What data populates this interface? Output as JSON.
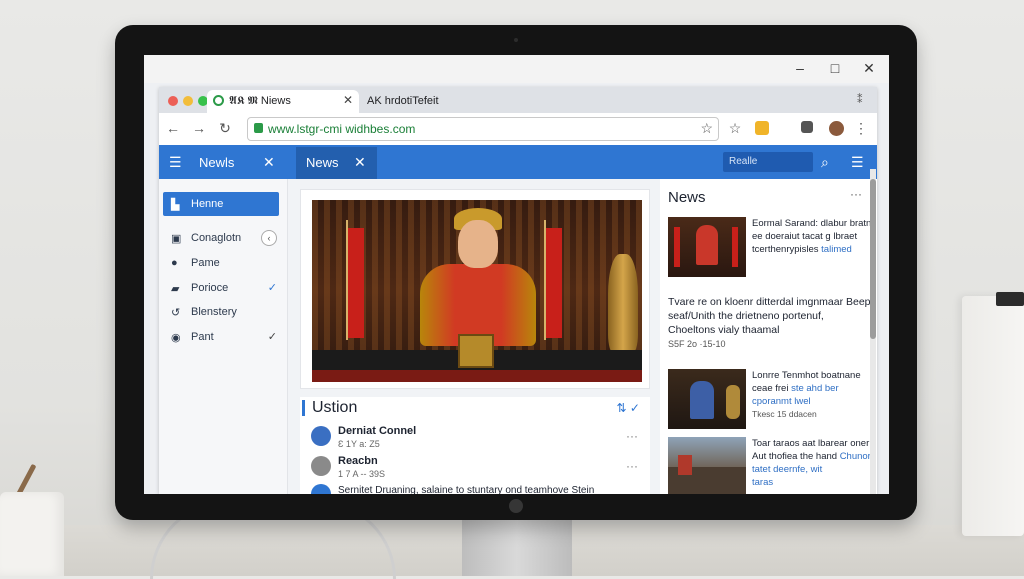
{
  "browser": {
    "tab1_title": "𝕬𝕶 𝕸 Niews",
    "tab2_title": "AK hrdotiTefeit",
    "url": "www.lstgr-cmi widhbes.com"
  },
  "appbar": {
    "brand": "Newls",
    "active_tab": "News",
    "search_placeholder": "Realle"
  },
  "sidebar": {
    "items": [
      {
        "label": "Henne",
        "trail": ""
      },
      {
        "label": "Conaglotn",
        "trail": "‹"
      },
      {
        "label": "Pame",
        "trail": ""
      },
      {
        "label": "Porioce",
        "trail": "✓"
      },
      {
        "label": "Blenstery",
        "trail": ""
      },
      {
        "label": "Pant",
        "trail": "✓"
      }
    ]
  },
  "section": {
    "title": "Ustion",
    "rows": [
      {
        "name": "Derniat Connel",
        "sub": "Ɛ 1Y a: Z5"
      },
      {
        "name": "Reacbn",
        "sub": "1 7 A -- 39S"
      },
      {
        "tail": "Sernitet Druaning, salaine to stuntary ond teamhove Stein"
      }
    ]
  },
  "news": {
    "heading": "News",
    "items": [
      {
        "text": "Eormal Sarand: dlabur bratn ee doeraiut tacat g lbraet tcerthenrypisles",
        "blue": "talimed"
      },
      {
        "text": "Tvare re on kloenr ditterdal imgnmaar Beep seaf/Unith the drietneno portenuf, Choeltons vialy thaamal",
        "date": "S5F 2o ·15-10"
      },
      {
        "text": "Lonrre Tenmhot boatnane ceae frei",
        "blue": "ste ahd ber cporanmt lwel",
        "date": "Tkesc 15 ddacen"
      },
      {
        "text": "Toar taraos aat lbarear oner Aut thofiea the hand",
        "blue": "Chunorl tatet deernfe, wit",
        "date": "taras"
      }
    ]
  }
}
